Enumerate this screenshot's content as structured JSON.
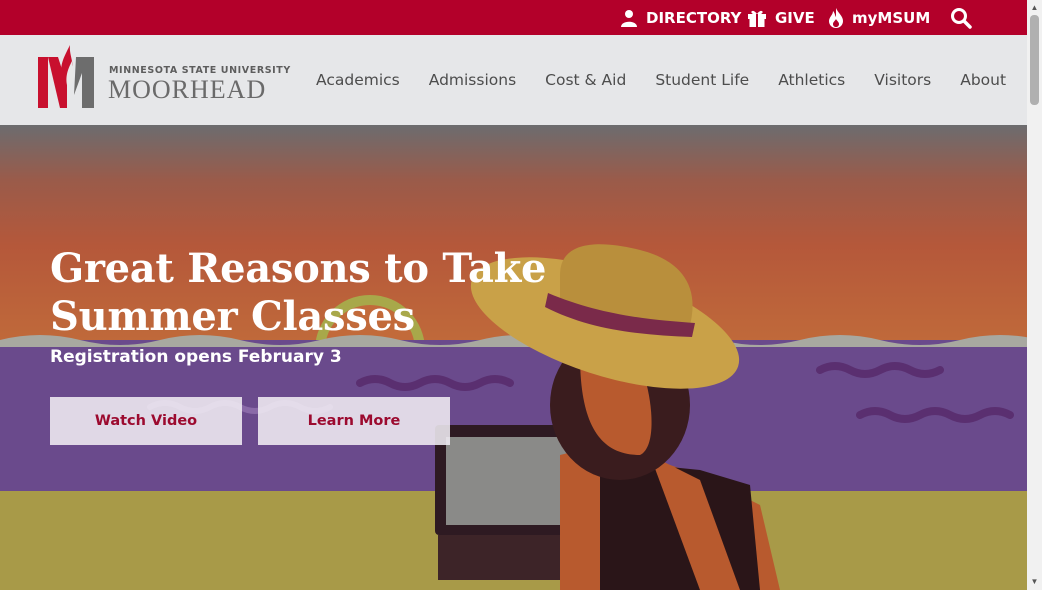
{
  "utility": {
    "directory": "DIRECTORY",
    "give": "GIVE",
    "mymsum": "myMSUM",
    "search_icon": "search-icon"
  },
  "logo": {
    "line1": "MINNESOTA STATE UNIVERSITY",
    "line2": "MOORHEAD"
  },
  "nav": {
    "items": [
      "Academics",
      "Admissions",
      "Cost & Aid",
      "Student Life",
      "Athletics",
      "Visitors",
      "About"
    ]
  },
  "hero": {
    "title": "Great Reasons to Take Summer Classes",
    "subtitle": "Registration opens February 3",
    "buttons": {
      "watch": "Watch Video",
      "learn": "Learn More"
    }
  },
  "colors": {
    "brand_red": "#b3002a",
    "header_gray": "#e6e7e9",
    "button_text": "#9c0a2f"
  }
}
